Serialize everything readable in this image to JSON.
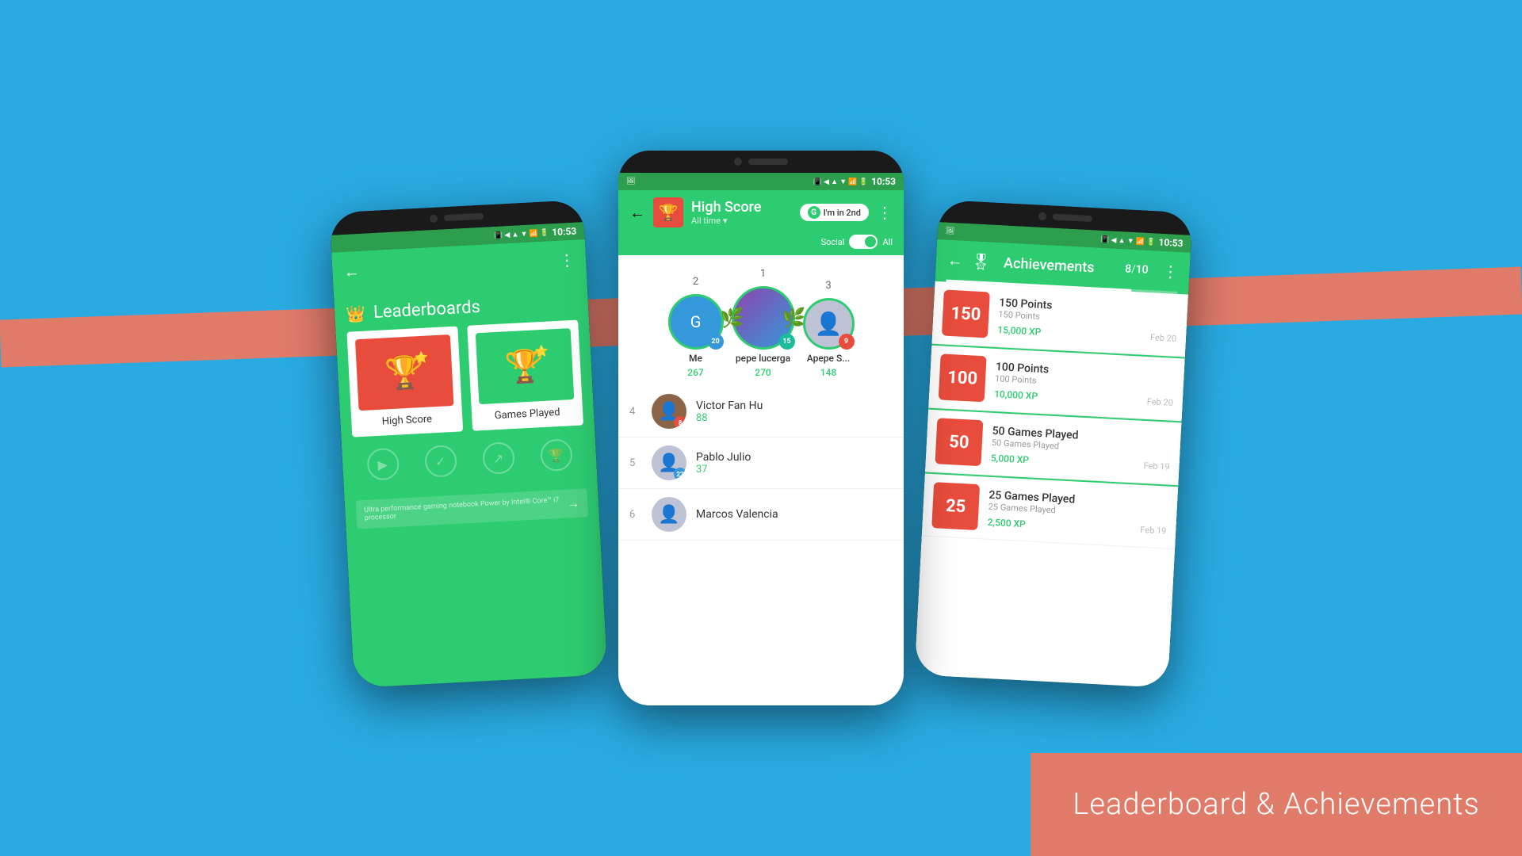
{
  "background_color": "#29ABE2",
  "red_banner_color": "#E07B6A",
  "bottom_label": {
    "text": "Leaderboard & Achievements",
    "bg_color": "#E07B6A",
    "text_color": "#FFFFFF"
  },
  "phones": {
    "left": {
      "status_bar": {
        "time": "10:53"
      },
      "app_bar": {
        "title": ""
      },
      "screen": {
        "title": "Leaderboards",
        "cards": [
          {
            "label": "High Score",
            "icon_type": "red"
          },
          {
            "label": "Games Played",
            "icon_type": "green"
          }
        ],
        "ad_text": "Ultra performance gaming notebook\nPower by Intel® Core™ i7 processor"
      }
    },
    "center": {
      "status_bar": {
        "time": "10:53"
      },
      "app_bar": {
        "title": "High Score",
        "subtitle": "All time",
        "badge": "I'm in 2nd",
        "social_label": "Social",
        "all_label": "All"
      },
      "podium": [
        {
          "rank": "2",
          "name": "Me",
          "score": "267",
          "badge_num": "20",
          "badge_color": "blue"
        },
        {
          "rank": "1",
          "name": "pepe lucerga",
          "score": "270",
          "badge_num": "15",
          "badge_color": "teal"
        },
        {
          "rank": "3",
          "name": "Apepe S...",
          "score": "148",
          "badge_num": "9",
          "badge_color": "red"
        }
      ],
      "list_rows": [
        {
          "rank": "4",
          "name": "Victor Fan Hu",
          "score": "88",
          "badge_num": "8",
          "badge_color": "red"
        },
        {
          "rank": "5",
          "name": "Pablo Julio",
          "score": "37",
          "badge_num": "22",
          "badge_color": "blue"
        },
        {
          "rank": "6",
          "name": "Marcos Valencia",
          "score": "",
          "badge_num": "",
          "badge_color": "blue"
        }
      ]
    },
    "right": {
      "status_bar": {
        "time": "10:53"
      },
      "app_bar": {
        "title": "Achievements"
      },
      "achievements_count": "8",
      "achievements_total": "10",
      "achievements_progress_pct": "80",
      "achievements": [
        {
          "label": "150",
          "name": "150 Points",
          "desc": "150 Points",
          "xp": "15,000 XP",
          "date": "Feb 20"
        },
        {
          "label": "100",
          "name": "100 Points",
          "desc": "100 Points",
          "xp": "10,000 XP",
          "date": "Feb 20"
        },
        {
          "label": "50",
          "name": "50 Games Played",
          "desc": "50 Games Played",
          "xp": "5,000 XP",
          "date": "Feb 19"
        },
        {
          "label": "25",
          "name": "25 Games Played",
          "desc": "25 Games Played",
          "xp": "2,500 XP",
          "date": "Feb 19"
        }
      ]
    }
  }
}
